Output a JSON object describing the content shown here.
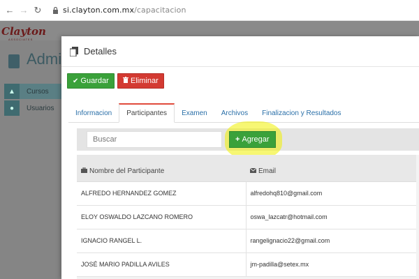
{
  "browser": {
    "back_icon": "arrow-left-icon",
    "forward_icon": "arrow-right-icon",
    "reload_icon": "reload-icon",
    "lock_icon": "lock-icon",
    "url_host": "si.clayton.com.mx",
    "url_path": "/capacitacion"
  },
  "app": {
    "logo_text": "Clayton",
    "logo_subtitle": "ASSOCIATES",
    "title": "Admin",
    "sidebar": [
      {
        "label": "Cursos",
        "icon": "graduation-cap-icon"
      },
      {
        "label": "Usuarios",
        "icon": "user-icon"
      }
    ]
  },
  "modal": {
    "title": "Detalles",
    "title_icon": "document-icon",
    "actions": {
      "save_label": "Guardar",
      "delete_label": "Eliminar"
    },
    "tabs": [
      {
        "label": "Informacion",
        "active": false
      },
      {
        "label": "Participantes",
        "active": true
      },
      {
        "label": "Examen",
        "active": false
      },
      {
        "label": "Archivos",
        "active": false
      },
      {
        "label": "Finalizacion y Resultados",
        "active": false
      }
    ],
    "search_placeholder": "Buscar",
    "add_label": "Agregar",
    "table": {
      "columns": [
        {
          "label": "Nombre del Participante",
          "icon": "briefcase-icon"
        },
        {
          "label": "Email",
          "icon": "envelope-icon"
        }
      ],
      "rows": [
        {
          "name": "ALFREDO HERNANDEZ GOMEZ",
          "email": "alfredohq810@gmail.com"
        },
        {
          "name": "ELOY OSWALDO LAZCANO ROMERO",
          "email": "oswa_lazcatr@hotmail.com"
        },
        {
          "name": "IGNACIO RANGEL L.",
          "email": "rangelignacio22@gmail.com"
        },
        {
          "name": "JOSÉ MARIO PADILLA AVILES",
          "email": "jm-padilla@setex.mx"
        }
      ]
    }
  },
  "colors": {
    "success": "#3aa13a",
    "danger": "#d33a32",
    "link": "#2a6fa8",
    "active_tab_accent": "#e04b3c",
    "highlight": "#f0f000"
  }
}
